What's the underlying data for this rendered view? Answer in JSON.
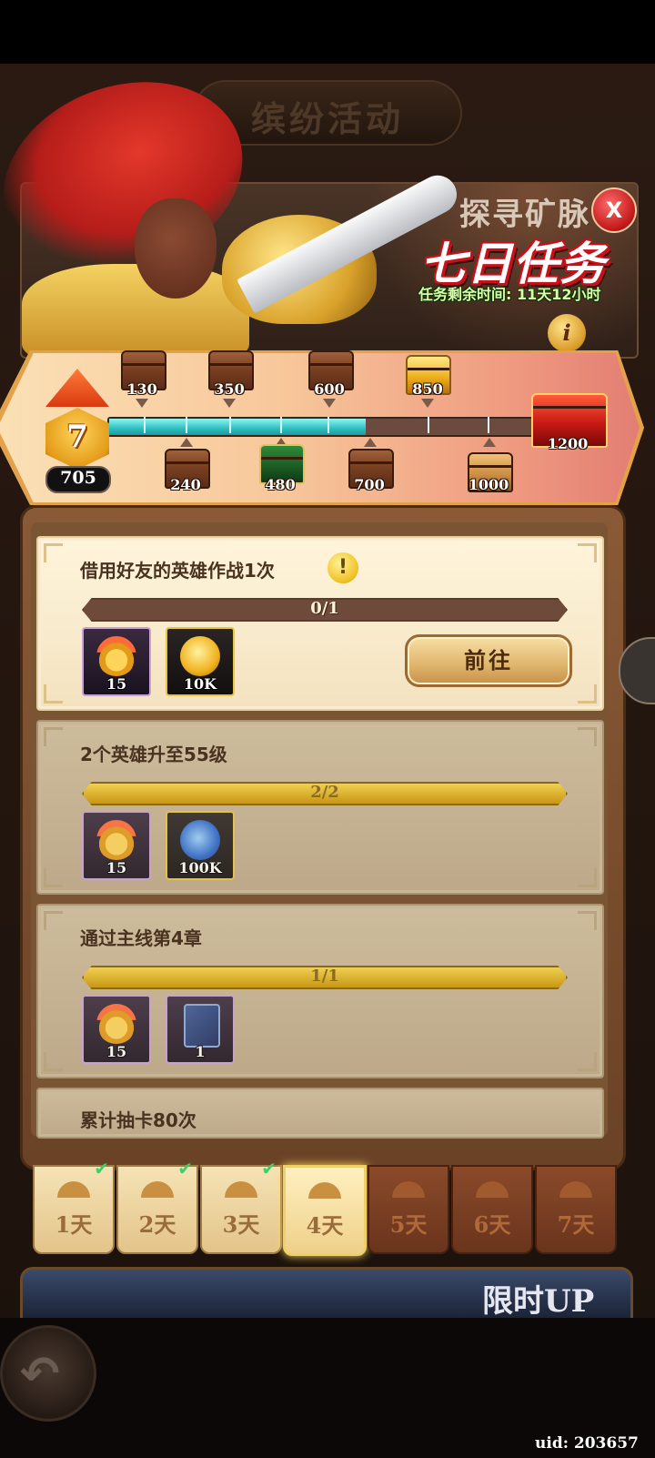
{
  "header": {
    "title": "缤纷活动"
  },
  "event": {
    "subtitle": "探寻矿脉",
    "title": "七日任务",
    "timer_text": "任务剩余时间: 11天12小时",
    "close_label": "X",
    "info_label": "i"
  },
  "progress": {
    "level": "7",
    "points": "705",
    "max": 1200,
    "current": 705,
    "milestones_top": [
      "130",
      "350",
      "600",
      "850"
    ],
    "milestones_bottom": [
      "240",
      "480",
      "700",
      "1000"
    ],
    "final_milestone": "1200"
  },
  "tasks": [
    {
      "title": "借用好友的英雄作战1次",
      "progress": "0/1",
      "ratio": 0,
      "rewards": [
        {
          "icon": "medal-icon",
          "qty": "15"
        },
        {
          "icon": "gold-coin-icon",
          "qty": "10K"
        }
      ],
      "button_label": "前往"
    },
    {
      "title": "2个英雄升至55级",
      "progress": "2/2",
      "ratio": 1,
      "rewards": [
        {
          "icon": "medal-icon",
          "qty": "15"
        },
        {
          "icon": "exp-potion-icon",
          "qty": "100K"
        }
      ]
    },
    {
      "title": "通过主线第4章",
      "progress": "1/1",
      "ratio": 1,
      "rewards": [
        {
          "icon": "medal-icon",
          "qty": "15"
        },
        {
          "icon": "hero-card-icon",
          "qty": "1"
        }
      ]
    },
    {
      "title": "累计抽卡80次"
    }
  ],
  "day_tabs": [
    {
      "label": "1天",
      "state": "completed"
    },
    {
      "label": "2天",
      "state": "completed"
    },
    {
      "label": "3天",
      "state": "completed"
    },
    {
      "label": "4天",
      "state": "selected"
    },
    {
      "label": "5天",
      "state": "locked"
    },
    {
      "label": "6天",
      "state": "locked"
    },
    {
      "label": "7天",
      "state": "locked"
    }
  ],
  "footer": {
    "limited_banner": "限时UP",
    "uid": "uid: 203657"
  },
  "colors": {
    "progress_fill": "#2fbfc0",
    "complete_bar": "#e0b830",
    "title_red": "#c8101a",
    "timer_green": "#d8ffa8"
  }
}
